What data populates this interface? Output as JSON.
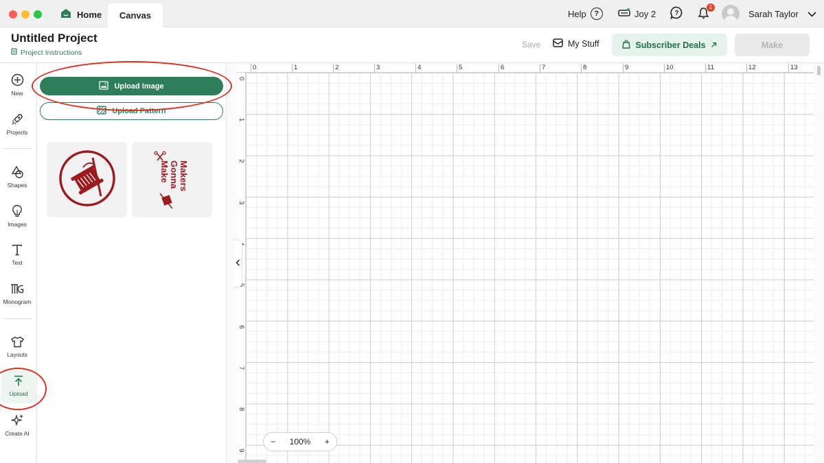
{
  "titlebar": {
    "tabs": [
      {
        "label": "Home",
        "icon": "home-icon"
      },
      {
        "label": "Canvas"
      }
    ],
    "help_label": "Help",
    "help_icon": "?",
    "machine_label": "Joy 2",
    "chat_icon": "?",
    "notification_count": "1",
    "user_name": "Sarah Taylor"
  },
  "project": {
    "title": "Untitled Project",
    "instructions_label": "Project Instructions"
  },
  "toolbar": {
    "save_label": "Save",
    "mystuff_label": "My Stuff",
    "deals_label": "Subscriber Deals",
    "make_label": "Make"
  },
  "nav": {
    "items": [
      {
        "label": "New",
        "icon": "plus-circle-icon"
      },
      {
        "label": "Projects",
        "icon": "rocket-icon"
      },
      {
        "label": "Shapes",
        "icon": "shapes-icon"
      },
      {
        "label": "Images",
        "icon": "bulb-icon"
      },
      {
        "label": "Text",
        "icon": "text-icon"
      },
      {
        "label": "Monogram",
        "icon": "monogram-icon"
      },
      {
        "label": "Layouts",
        "icon": "shirt-icon"
      },
      {
        "label": "Upload",
        "icon": "upload-icon",
        "active": true
      },
      {
        "label": "Create AI",
        "icon": "sparkle-icon"
      }
    ]
  },
  "panel": {
    "upload_image_label": "Upload Image",
    "upload_pattern_label": "Upload Pattern",
    "thumb_b_text": [
      "Makers",
      "Gonna",
      "Make"
    ]
  },
  "canvas": {
    "ruler_x": [
      "0",
      "1",
      "2",
      "3",
      "4",
      "5",
      "6",
      "7",
      "8",
      "9",
      "10",
      "11",
      "12",
      "13"
    ],
    "ruler_y": [
      "0",
      "1",
      "2",
      "3",
      "4",
      "5",
      "6",
      "7",
      "8",
      "9"
    ],
    "zoom_minus": "−",
    "zoom_level": "100%",
    "zoom_plus": "+"
  },
  "colors": {
    "brand_green": "#2e7d5b",
    "annotation_red": "#d9301f",
    "thumbnail_red": "#9b1b1f"
  }
}
